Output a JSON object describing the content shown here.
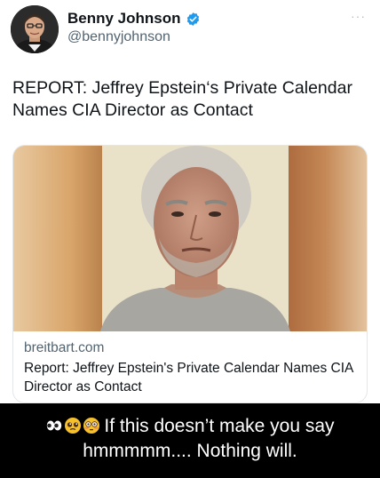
{
  "tweet": {
    "author": {
      "name": "Benny Johnson",
      "handle": "@bennyjohnson",
      "verified": true
    },
    "more_glyph": "···",
    "text": "REPORT: Jeffrey Epstein‘s Private Calendar Names CIA Director as Contact",
    "card": {
      "domain": "breitbart.com",
      "title": "Report: Jeffrey Epstein's Private Calendar Names CIA Director as Contact"
    }
  },
  "caption": {
    "emojis": [
      "eyes-emoji",
      "pleading-face-emoji",
      "flushed-face-emoji"
    ],
    "text": "If this doesn’t make you say hmmmmm.... Nothing will."
  },
  "colors": {
    "verified_blue": "#1d9bf0",
    "caption_background": "#000000"
  }
}
